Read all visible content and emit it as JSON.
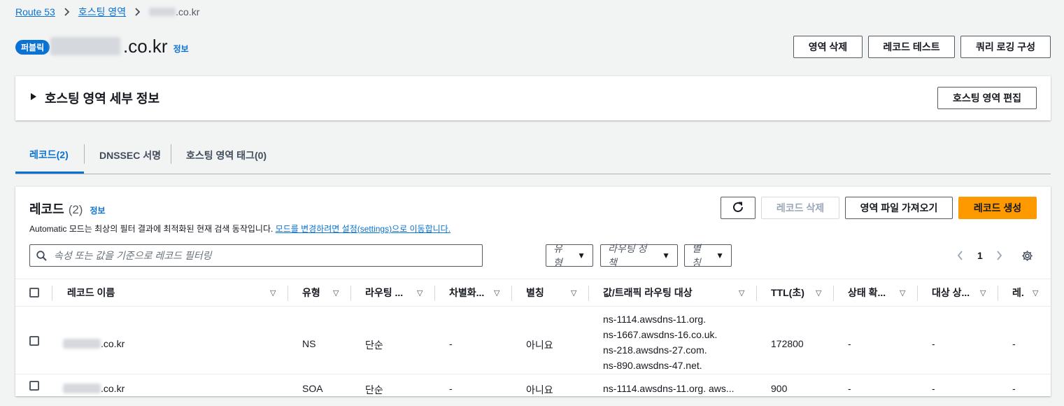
{
  "breadcrumb": {
    "items": [
      "Route 53",
      "호스팅 영역"
    ],
    "current_suffix": ".co.kr"
  },
  "header": {
    "badge": "퍼블릭",
    "title_suffix": ".co.kr",
    "info": "정보",
    "actions": [
      "영역 삭제",
      "레코드 테스트",
      "쿼리 로깅 구성"
    ]
  },
  "details": {
    "title": "호스팅 영역 세부 정보",
    "edit_button": "호스팅 영역 편집"
  },
  "tabs": [
    "레코드(2)",
    "DNSSEC 서명",
    "호스팅 영역 태그(0)"
  ],
  "records": {
    "title": "레코드",
    "count": "(2)",
    "info": "정보",
    "desc_prefix": "Automatic 모드는 최상의 필터 결과에 최적화된 현재 검색 동작입니다. ",
    "desc_link": "모드를 변경하려면 설정(settings)으로 이동합니다.",
    "buttons": {
      "delete": "레코드 삭제",
      "import": "영역 파일 가져오기",
      "create": "레코드 생성"
    },
    "search_placeholder": "속성 또는 값을 기준으로 레코드 필터링",
    "filters": [
      "유형",
      "라우팅 정책",
      "별칭"
    ],
    "page": "1",
    "columns": [
      "레코드 이름",
      "유형",
      "라우팅 ...",
      "차별화...",
      "별칭",
      "값/트래픽 라우팅 대상",
      "TTL(초)",
      "상태 확...",
      "대상 상...",
      "레."
    ],
    "rows": [
      {
        "name_suffix": ".co.kr",
        "type": "NS",
        "routing": "단순",
        "diff": "-",
        "alias": "아니요",
        "values": [
          "ns-1114.awsdns-11.org.",
          "ns-1667.awsdns-16.co.uk.",
          "ns-218.awsdns-27.com.",
          "ns-890.awsdns-47.net."
        ],
        "ttl": "172800",
        "health": "-",
        "target": "-",
        "rec": "-"
      },
      {
        "name_suffix": ".co.kr",
        "type": "SOA",
        "routing": "단순",
        "diff": "-",
        "alias": "아니요",
        "value": "ns-1114.awsdns-11.org. aws...",
        "ttl": "900",
        "health": "-",
        "target": "-",
        "rec": "-"
      }
    ]
  },
  "colors": {
    "link": "#0972d3",
    "primary": "#ff9900",
    "background": "#f2f3f3"
  },
  "icons": [
    "chevron-right-icon",
    "caret-right-icon",
    "refresh-icon",
    "search-icon",
    "caret-down-icon",
    "chevron-left-icon",
    "settings-gear-icon"
  ]
}
